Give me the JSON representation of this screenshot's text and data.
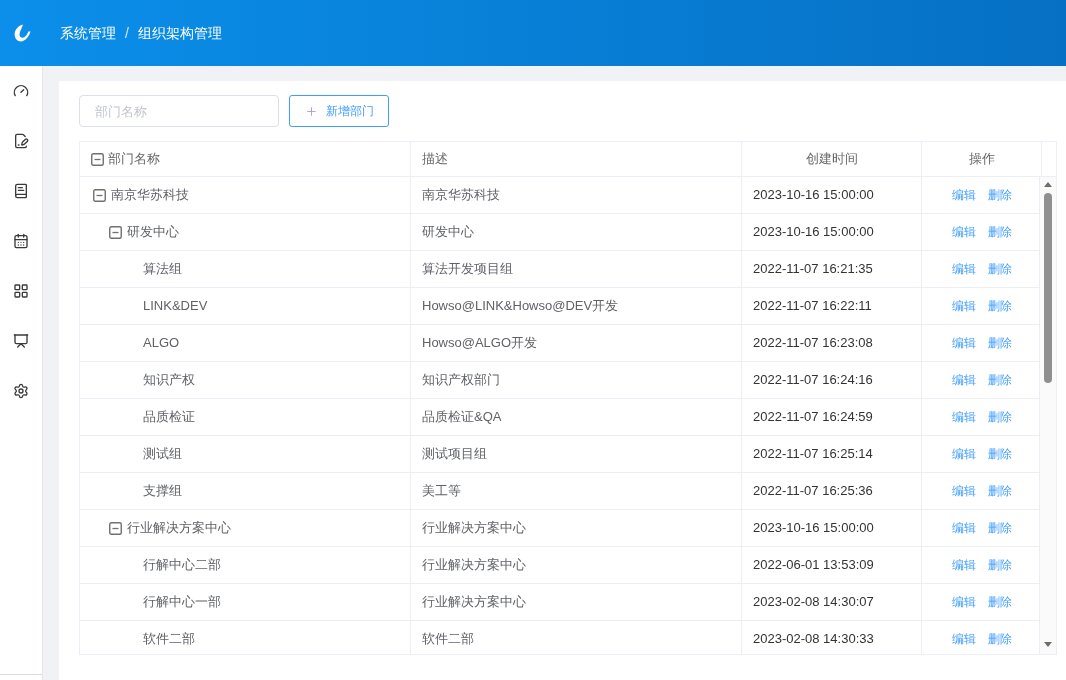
{
  "header": {
    "breadcrumb": [
      "系统管理",
      "组织架构管理"
    ],
    "separator": "/"
  },
  "toolbar": {
    "search": {
      "placeholder": "部门名称"
    },
    "add_button": {
      "label": "新增部门"
    }
  },
  "table": {
    "expand_all": true,
    "columns": [
      "部门名称",
      "描述",
      "创建时间",
      "操作"
    ],
    "rows": [
      {
        "name": "南京华苏科技",
        "description": "南京华苏科技",
        "created": "2023-10-16 15:00:00",
        "actions": [
          "编辑",
          "删除"
        ],
        "expanded": true,
        "children": [
          {
            "name": "研发中心",
            "description": "研发中心",
            "created": "2023-10-16 15:00:00",
            "actions": [
              "编辑",
              "删除"
            ],
            "expanded": true,
            "children": [
              {
                "name": "算法组",
                "description": "算法开发项目组",
                "created": "2022-11-07 16:21:35",
                "actions": [
                  "编辑",
                  "删除"
                ]
              },
              {
                "name": "LINK&DEV",
                "description": "Howso@LINK&Howso@DEV开发",
                "created": "2022-11-07 16:22:11",
                "actions": [
                  "编辑",
                  "删除"
                ]
              },
              {
                "name": "ALGO",
                "description": "Howso@ALGO开发",
                "created": "2022-11-07 16:23:08",
                "actions": [
                  "编辑",
                  "删除"
                ]
              },
              {
                "name": "知识产权",
                "description": "知识产权部门",
                "created": "2022-11-07 16:24:16",
                "actions": [
                  "编辑",
                  "删除"
                ]
              },
              {
                "name": "品质检证",
                "description": "品质检证&QA",
                "created": "2022-11-07 16:24:59",
                "actions": [
                  "编辑",
                  "删除"
                ]
              },
              {
                "name": "测试组",
                "description": "测试项目组",
                "created": "2022-11-07 16:25:14",
                "actions": [
                  "编辑",
                  "删除"
                ]
              },
              {
                "name": "支撑组",
                "description": "美工等",
                "created": "2022-11-07 16:25:36",
                "actions": [
                  "编辑",
                  "删除"
                ]
              }
            ]
          },
          {
            "name": "行业解决方案中心",
            "description": "行业解决方案中心",
            "created": "2023-10-16 15:00:00",
            "actions": [
              "编辑",
              "删除"
            ],
            "expanded": true,
            "children": [
              {
                "name": "行解中心二部",
                "description": "行业解决方案中心",
                "created": "2022-06-01 13:53:09",
                "actions": [
                  "编辑",
                  "删除"
                ]
              },
              {
                "name": "行解中心一部",
                "description": "行业解决方案中心",
                "created": "2023-02-08 14:30:07",
                "actions": [
                  "编辑",
                  "删除"
                ]
              },
              {
                "name": "软件二部",
                "description": "软件二部",
                "created": "2023-02-08 14:30:33",
                "actions": [
                  "编辑",
                  "删除"
                ]
              }
            ]
          }
        ]
      }
    ]
  }
}
